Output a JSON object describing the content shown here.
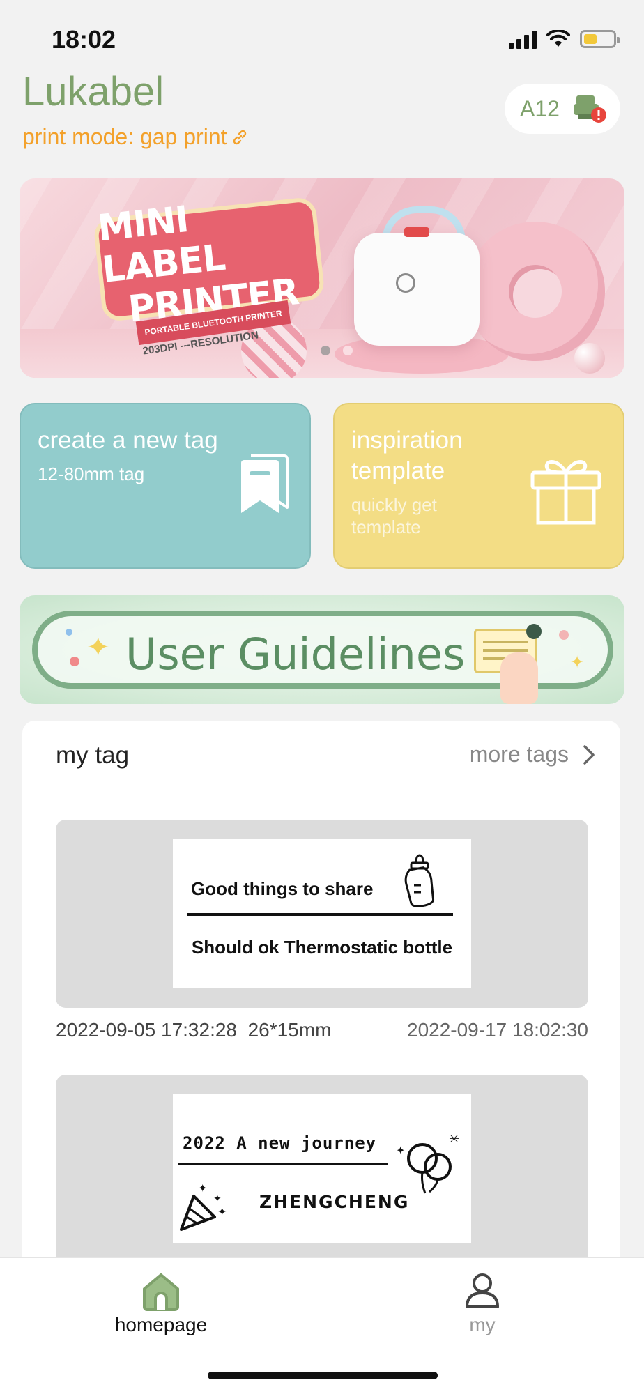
{
  "status_bar": {
    "time": "18:02"
  },
  "header": {
    "app_title": "Lukabel",
    "print_mode": "print mode: gap print",
    "device_name": "A12"
  },
  "banner": {
    "headline_line1": "MINI LABEL",
    "headline_line2": "PRINTER",
    "ribbon": "PORTABLE BLUETOOTH PRINTER",
    "resolution": "203DPI ---RESOLUTION",
    "slide_count": 2,
    "active_slide": 0
  },
  "cards": {
    "create": {
      "title": "create a new tag",
      "subtitle": "12-80mm tag",
      "icon": "bookmark-icon"
    },
    "template": {
      "title": "inspiration template",
      "subtitle": "quickly get template",
      "icon": "gift-icon"
    }
  },
  "guidelines": {
    "text": "User Guidelines"
  },
  "my_tag": {
    "title": "my tag",
    "more_label": "more tags",
    "tags": [
      {
        "line1": "Good things to share",
        "line2": "Should ok Thermostatic bottle",
        "created": "2022-09-05 17:32:28",
        "size": "26*15mm",
        "modified": "2022-09-17 18:02:30"
      },
      {
        "line1": "2022 A new journey",
        "line2": "ZHENGCHENG"
      }
    ]
  },
  "nav": {
    "items": [
      {
        "label": "homepage",
        "icon": "home-icon",
        "active": true
      },
      {
        "label": "my",
        "icon": "user-icon",
        "active": false
      }
    ]
  },
  "colors": {
    "brand_green": "#7ea16b",
    "print_mode_orange": "#f3a12b",
    "create_card": "#92cccc",
    "template_card": "#f3dd85",
    "warning_red": "#e8453c"
  }
}
